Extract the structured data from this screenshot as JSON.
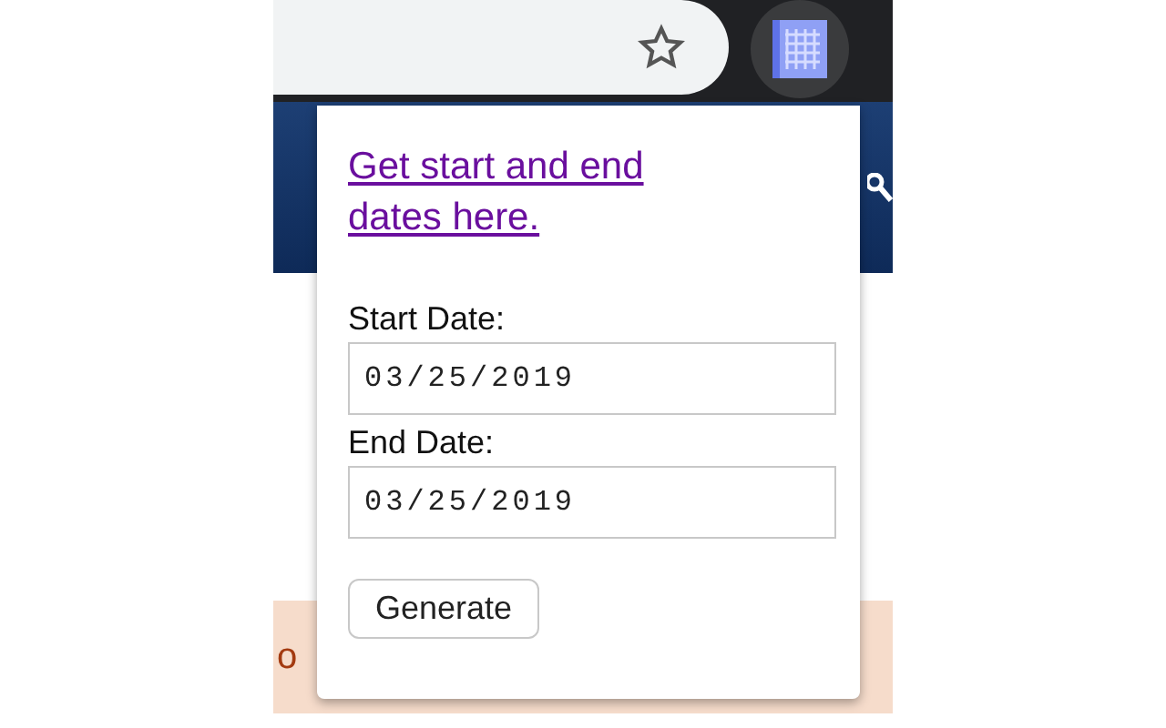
{
  "popup": {
    "link": "Get start and end dates here.",
    "fields": [
      {
        "label": "Start Date:",
        "value": "03/25/2019"
      },
      {
        "label": "End Date:",
        "value": "03/25/2019"
      }
    ],
    "button": "Generate"
  },
  "page_behind": {
    "banner_text": "o"
  }
}
